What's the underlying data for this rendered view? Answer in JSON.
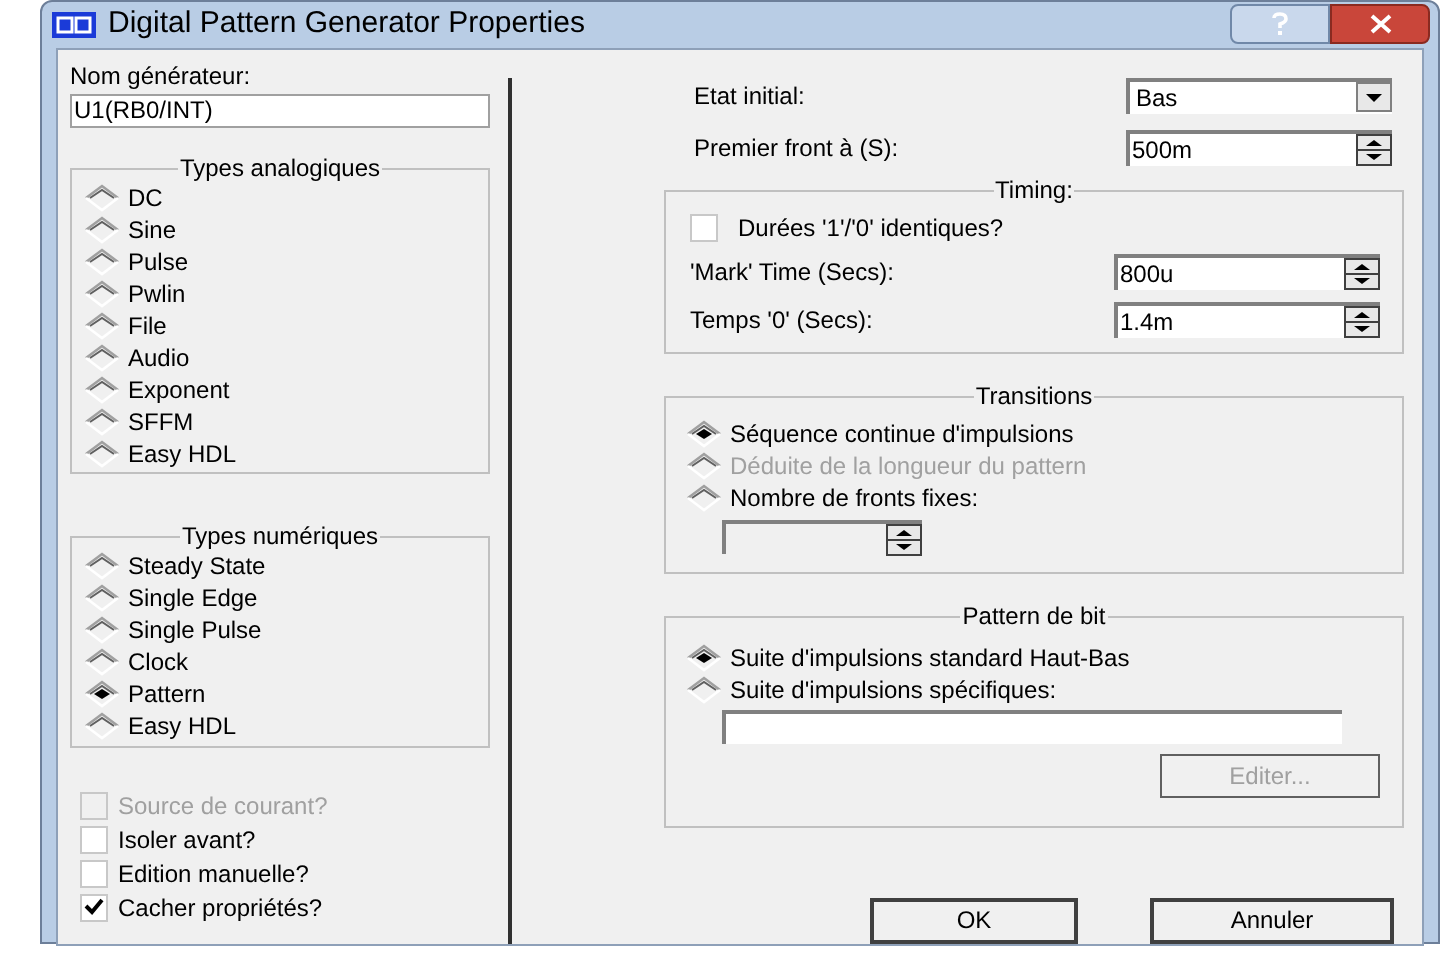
{
  "window": {
    "title": "Digital Pattern Generator Properties"
  },
  "generator_name": {
    "label": "Nom générateur:",
    "value": "U1(RB0/INT)"
  },
  "analog_types": {
    "title": "Types analogiques",
    "items": [
      {
        "label": "DC",
        "selected": false
      },
      {
        "label": "Sine",
        "selected": false
      },
      {
        "label": "Pulse",
        "selected": false
      },
      {
        "label": "Pwlin",
        "selected": false
      },
      {
        "label": "File",
        "selected": false
      },
      {
        "label": "Audio",
        "selected": false
      },
      {
        "label": "Exponent",
        "selected": false
      },
      {
        "label": "SFFM",
        "selected": false
      },
      {
        "label": "Easy HDL",
        "selected": false
      }
    ]
  },
  "digital_types": {
    "title": "Types numériques",
    "items": [
      {
        "label": "Steady State",
        "selected": false
      },
      {
        "label": "Single Edge",
        "selected": false
      },
      {
        "label": "Single Pulse",
        "selected": false
      },
      {
        "label": "Clock",
        "selected": false
      },
      {
        "label": "Pattern",
        "selected": true
      },
      {
        "label": "Easy HDL",
        "selected": false
      }
    ]
  },
  "options": [
    {
      "label": "Source de courant?",
      "checked": false,
      "disabled": true
    },
    {
      "label": "Isoler avant?",
      "checked": false,
      "disabled": false
    },
    {
      "label": "Edition manuelle?",
      "checked": false,
      "disabled": false
    },
    {
      "label": "Cacher propriétés?",
      "checked": true,
      "disabled": false
    }
  ],
  "initial_state": {
    "label": "Etat initial:",
    "value": "Bas"
  },
  "first_edge": {
    "label": "Premier front à (S):",
    "value": "500m"
  },
  "timing": {
    "title": "Timing:",
    "equal_durations": {
      "label": "Durées '1'/'0' identiques?",
      "checked": false
    },
    "fields": [
      {
        "label": "'Mark' Time (Secs):",
        "value": "800u"
      },
      {
        "label": "Temps '0' (Secs):",
        "value": "1.4m"
      }
    ]
  },
  "transitions": {
    "title": "Transitions",
    "items": [
      {
        "label": "Séquence continue d'impulsions",
        "selected": true,
        "disabled": false
      },
      {
        "label": "Déduite de la longueur du pattern",
        "selected": false,
        "disabled": true
      },
      {
        "label": "Nombre de fronts fixes:",
        "selected": false,
        "disabled": false
      }
    ]
  },
  "bit_pattern": {
    "title": "Pattern de bit",
    "items": [
      {
        "label": "Suite d'impulsions standard Haut-Bas",
        "selected": true,
        "disabled": false
      },
      {
        "label": "Suite d'impulsions spécifiques:",
        "selected": false,
        "disabled": false
      }
    ],
    "edit_button": {
      "label": "Editer...",
      "disabled": true
    }
  },
  "buttons": [
    "OK",
    "Annuler"
  ]
}
